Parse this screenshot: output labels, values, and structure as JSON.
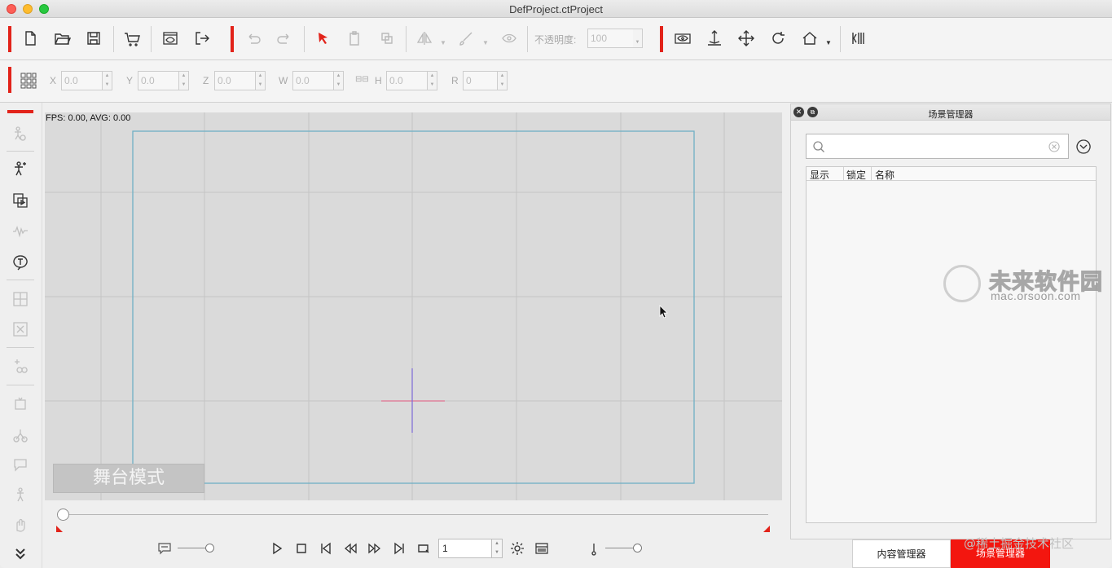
{
  "window": {
    "title": "DefProject.ctProject"
  },
  "toolbar": {
    "opacity_label": "不透明度:",
    "opacity_value": "100"
  },
  "transform": {
    "x_label": "X",
    "x_value": "0.0",
    "y_label": "Y",
    "y_value": "0.0",
    "z_label": "Z",
    "z_value": "0.0",
    "w_label": "W",
    "w_value": "0.0",
    "h_label": "H",
    "h_value": "0.0",
    "r_label": "R",
    "r_value": "0"
  },
  "canvas": {
    "fps_text": "FPS: 0.00, AVG: 0.00",
    "stage_mode_label": "舞台模式"
  },
  "playback": {
    "frame_value": "1"
  },
  "scene_panel": {
    "title": "场景管理器",
    "columns": [
      "显示",
      "锁定",
      "名称"
    ]
  },
  "tabs": {
    "content_manager": "内容管理器",
    "scene_manager": "场景管理器"
  },
  "watermarks": {
    "brand_cn": "未来软件园",
    "brand_url": "mac.orsoon.com",
    "community": "@稀土掘金技术社区"
  }
}
